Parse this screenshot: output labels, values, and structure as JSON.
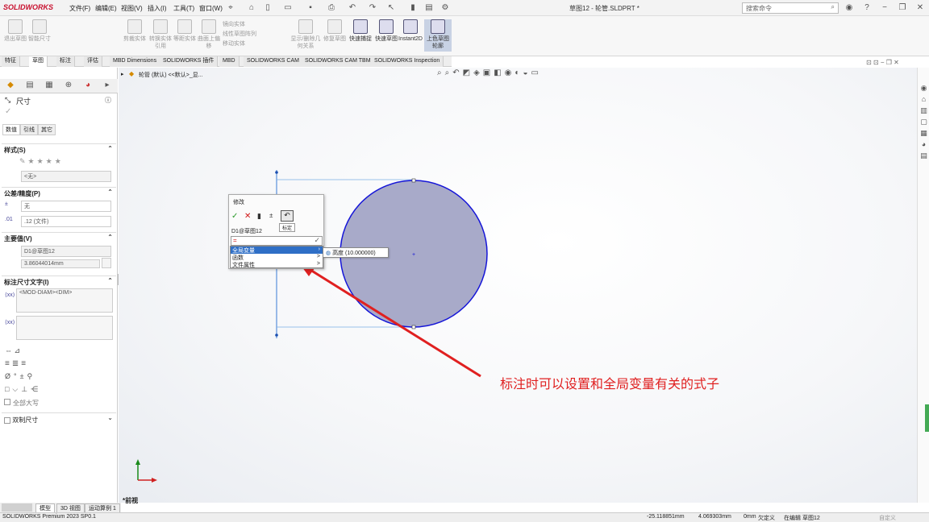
{
  "titlebar": {
    "app": "SOLIDWORKS",
    "menus": [
      "文件(F)",
      "编辑(E)",
      "视图(V)",
      "插入(I)",
      "工具(T)",
      "窗口(W)"
    ],
    "document": "草图12 - 轮管.SLDPRT *",
    "search_placeholder": "搜索命令"
  },
  "ribbon": {
    "buttons": [
      "退出草图",
      "智能尺寸",
      "剪裁实体",
      "转换实体引用",
      "等距实体",
      "曲面上偏移",
      "镜向实体",
      "线性草图阵列",
      "移动实体",
      "显示/删除几何关系",
      "修复草图",
      "快速捕捉",
      "快速草图",
      "Instant2D",
      "上色草图轮廓"
    ]
  },
  "tabs": [
    "特征",
    "草图",
    "标注",
    "评估",
    "MBD Dimensions",
    "SOLIDWORKS 插件",
    "MBD",
    "SOLIDWORKS CAM",
    "SOLIDWORKS CAM TBM",
    "SOLIDWORKS Inspection"
  ],
  "property_manager": {
    "title": "尺寸",
    "subtabs": [
      "数值",
      "引线",
      "其它"
    ],
    "style_header": "样式(S)",
    "style_value": "<无>",
    "tolerance_header": "公差/精度(P)",
    "tolerance_type": "无",
    "precision": ".12 (文件)",
    "primary_header": "主要值(V)",
    "primary_name": "D1@草图12",
    "primary_value": "3.86044014mm",
    "dimtext_header": "标注尺寸文字(I)",
    "dimtext_value": "<MOD-DIAM><DIM>",
    "all_caps": "全部大写",
    "dual_header": "双制尺寸"
  },
  "breadcrumb": "轮管 (默认) <<默认>_显...",
  "modify_dialog": {
    "title": "修改",
    "tooltip": "标定",
    "dim_name": "D1@草图12",
    "input_value": "=",
    "menu_items": [
      "全局变量",
      "函数",
      "文件属性"
    ],
    "submenu_item": "高度 (10.000000)"
  },
  "annotation_text": "标注时可以设置和全局变量有关的式子",
  "view_label": "*前视",
  "bottom_tabs": [
    "模型",
    "3D 视图",
    "运动算例 1"
  ],
  "status": {
    "product": "SOLIDWORKS Premium 2023 SP0.1",
    "x": "-25.118851mm",
    "y": "4.069303mm",
    "z": "0mm",
    "state": "欠定义",
    "editing": "在编辑 草图12",
    "custom": "自定义"
  },
  "colors": {
    "circle_fill": "#a8aac9",
    "circle_stroke": "#1515d8",
    "arrow": "#e02020",
    "menu_highlight": "#2f6fc6"
  }
}
